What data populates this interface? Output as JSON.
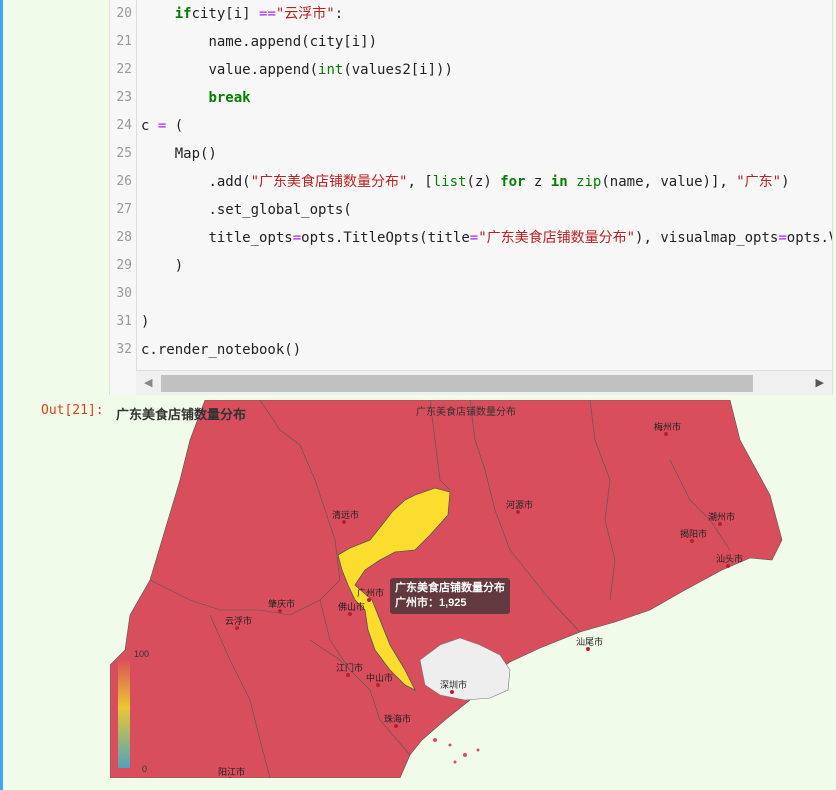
{
  "code": {
    "lines": [
      {
        "num": "20",
        "indent": "    ",
        "parts": [
          [
            "kw",
            "if"
          ],
          [
            "",
            "city[i] "
          ],
          [
            "op",
            "=="
          ],
          [
            "st",
            "\"云浮市\""
          ],
          [
            "",
            ":"
          ]
        ]
      },
      {
        "num": "21",
        "indent": "        ",
        "parts": [
          [
            "",
            "name.append(city[i])"
          ]
        ]
      },
      {
        "num": "22",
        "indent": "        ",
        "parts": [
          [
            "",
            "value.append("
          ],
          [
            "bi",
            "int"
          ],
          [
            "",
            "(values2[i]))"
          ]
        ]
      },
      {
        "num": "23",
        "indent": "        ",
        "parts": [
          [
            "kw",
            "break"
          ]
        ]
      },
      {
        "num": "24",
        "indent": "",
        "parts": [
          [
            "",
            "c "
          ],
          [
            "op",
            "="
          ],
          [
            "",
            " ("
          ]
        ]
      },
      {
        "num": "25",
        "indent": "    ",
        "parts": [
          [
            "",
            "Map()"
          ]
        ]
      },
      {
        "num": "26",
        "indent": "        ",
        "parts": [
          [
            "",
            ".add("
          ],
          [
            "st",
            "\"广东美食店铺数量分布\""
          ],
          [
            "",
            ", ["
          ],
          [
            "bi",
            "list"
          ],
          [
            "",
            "(z) "
          ],
          [
            "kw",
            "for"
          ],
          [
            "",
            " z "
          ],
          [
            "kw",
            "in"
          ],
          [
            "",
            " "
          ],
          [
            "bi",
            "zip"
          ],
          [
            "",
            "(name, value)], "
          ],
          [
            "st",
            "\"广东\""
          ],
          [
            "",
            ")"
          ]
        ]
      },
      {
        "num": "27",
        "indent": "        ",
        "parts": [
          [
            "",
            ".set_global_opts("
          ]
        ]
      },
      {
        "num": "28",
        "indent": "        ",
        "parts": [
          [
            "",
            "title_opts"
          ],
          [
            "op",
            "="
          ],
          [
            "",
            "opts.TitleOpts(title"
          ],
          [
            "op",
            "="
          ],
          [
            "st",
            "\"广东美食店铺数量分布\""
          ],
          [
            "",
            "), visualmap_opts"
          ],
          [
            "op",
            "="
          ],
          [
            "",
            "opts.VisualM"
          ]
        ]
      },
      {
        "num": "29",
        "indent": "    ",
        "parts": [
          [
            "",
            ")"
          ]
        ]
      },
      {
        "num": "30",
        "indent": "",
        "parts": []
      },
      {
        "num": "31",
        "indent": "",
        "parts": [
          [
            "",
            ")"
          ]
        ]
      },
      {
        "num": "32",
        "indent": "",
        "parts": [
          [
            "",
            "c.render_notebook()"
          ]
        ]
      }
    ]
  },
  "scroll": {
    "left_arrow": "◀",
    "right_arrow": "▶"
  },
  "output": {
    "prompt": "Out[21]:"
  },
  "chart_data": {
    "type": "map",
    "title": "广东美食店铺数量分布",
    "legend": [
      "广东美食店铺数量分布"
    ],
    "region": "广东",
    "series": [
      {
        "name": "广东美食店铺数量分布",
        "data": [
          [
            "广州市",
            1925
          ]
        ]
      }
    ],
    "visualmap": {
      "min": 0,
      "max": 100,
      "max_label": "100",
      "min_label": "0",
      "colors": [
        "#50a3ba",
        "#eac736",
        "#d94e5d"
      ]
    },
    "highlighted": "广州市",
    "highlight_color": "#fcdd2e",
    "base_color": "#d94e5d",
    "shenzhen_color": "#eeeeee",
    "cities": [
      "梅州市",
      "清远市",
      "河源市",
      "潮州市",
      "揭阳市",
      "汕头市",
      "广州市",
      "肇庆市",
      "佛山市",
      "云浮市",
      "汕尾市",
      "江门市",
      "中山市",
      "深圳市",
      "珠海市",
      "阳江市"
    ],
    "tooltip": {
      "series": "广东美食店铺数量分布",
      "city": "广州市",
      "value": "1,925",
      "separator": "："
    }
  }
}
